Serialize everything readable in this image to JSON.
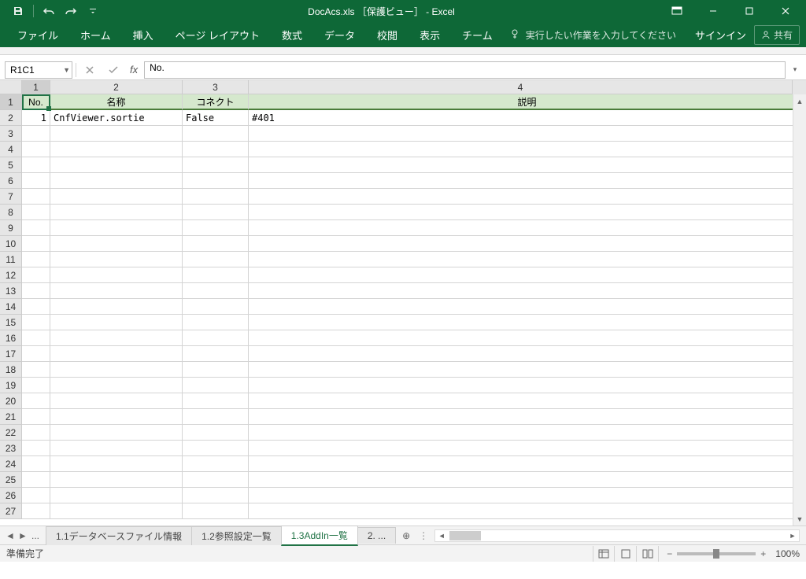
{
  "titlebar": {
    "title": "DocAcs.xls ［保護ビュー］ - Excel"
  },
  "ribbon": {
    "tabs": [
      "ファイル",
      "ホーム",
      "挿入",
      "ページ レイアウト",
      "数式",
      "データ",
      "校閲",
      "表示",
      "チーム"
    ],
    "tell_me": "実行したい作業を入力してください",
    "signin": "サインイン",
    "share": "共有"
  },
  "formula_bar": {
    "name_box": "R1C1",
    "formula": "No."
  },
  "grid": {
    "col_headers": [
      "1",
      "2",
      "3",
      "4"
    ],
    "row_headers": [
      "1",
      "2",
      "3",
      "4",
      "5",
      "6",
      "7",
      "8",
      "9",
      "10",
      "11",
      "12",
      "13",
      "14",
      "15",
      "16",
      "17",
      "18",
      "19",
      "20",
      "21",
      "22",
      "23",
      "24",
      "25",
      "26",
      "27"
    ],
    "header_row": [
      "No.",
      "名称",
      "コネクト",
      "説明"
    ],
    "data_rows": [
      [
        "1",
        "CnfViewer.sortie",
        "False",
        "#401"
      ]
    ]
  },
  "sheet_bar": {
    "ellipsis": "...",
    "tabs": [
      {
        "label": "1.1データベースファイル情報",
        "active": false
      },
      {
        "label": "1.2参照設定一覧",
        "active": false
      },
      {
        "label": "1.3AddIn一覧",
        "active": true
      },
      {
        "label": "2. ...",
        "active": false
      }
    ]
  },
  "status": {
    "ready": "準備完了",
    "zoom": "100%"
  }
}
